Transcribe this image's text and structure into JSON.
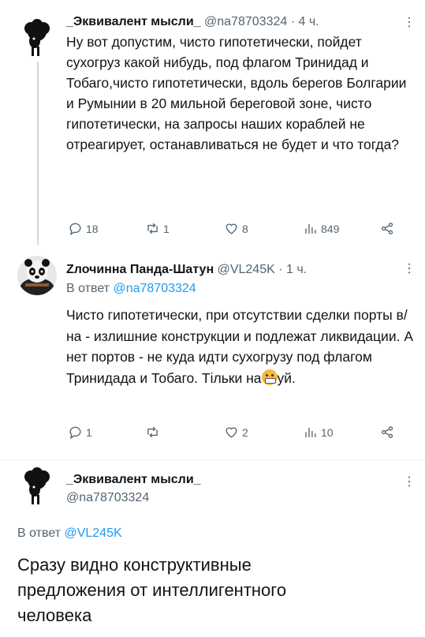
{
  "tweets": [
    {
      "name": "_Эквивалент мысли_",
      "handle": "@na78703324",
      "time": "· 4 ч.",
      "text": "Ну вот допустим, чисто гипотетически, пойдет сухогруз какой нибудь, под флагом Тринидад и Тобаго,чисто гипотетически, вдоль берегов Болгарии и Румынии в 20 мильной береговой зоне, чисто гипотетически, на запросы наших кораблей не отреагирует, останавливаться не будет и что тогда?",
      "stats": {
        "replies": "18",
        "retweets": "1",
        "likes": "8",
        "views": "849"
      },
      "avatar_icon": "black-sheep-avatar"
    },
    {
      "name": "Zлочинна Панда-Шатун",
      "handle": "@VL245K",
      "time": "· 1 ч.",
      "reply_prefix": "В ответ",
      "reply_handle": "@na78703324",
      "text": "Чисто гипотетически, при отсутствии сделки порты в/на - излишние конструкции и подлежат ликвидации. А нет портов - не куда идти сухогрузу под флагом Тринидада и Тобаго. Тільки на",
      "text_after_emoji": "уй.",
      "emoji": "grimacing-censored-emoji",
      "stats": {
        "replies": "1",
        "retweets": "",
        "likes": "2",
        "views": "10"
      },
      "avatar_icon": "kung-fu-panda-avatar"
    },
    {
      "name": "_Эквивалент мысли_",
      "handle": "@na78703324",
      "reply_prefix": "В ответ",
      "reply_handle": "@VL245K",
      "text": "Сразу видно конструктивные предложения от интеллигентного человека",
      "avatar_icon": "black-sheep-avatar"
    }
  ],
  "colors": {
    "link": "#1d9bf0",
    "muted": "#536471",
    "text": "#0f1419",
    "line": "#cfd9de"
  }
}
